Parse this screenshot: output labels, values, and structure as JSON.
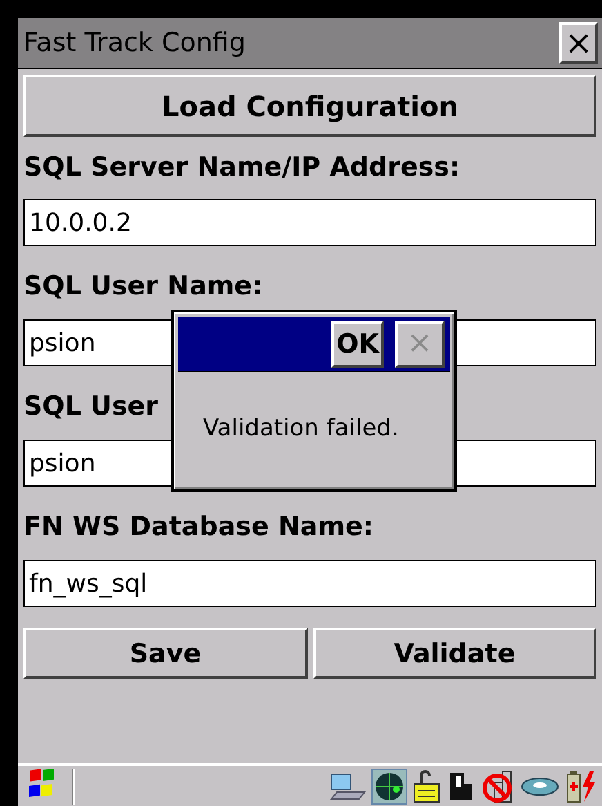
{
  "window": {
    "title": "Fast Track Config",
    "close": "×"
  },
  "load_button": "Load Configuration",
  "fields": [
    {
      "label": "SQL Server Name/IP Address:",
      "value": "10.0.0.2"
    },
    {
      "label": "SQL User Name:",
      "value": "psion"
    },
    {
      "label": "SQL User",
      "value": "psion"
    },
    {
      "label": "FN WS Database Name:",
      "value": "fn_ws_sql"
    }
  ],
  "buttons": [
    "Save",
    "Validate"
  ],
  "dialog": {
    "ok": "OK",
    "close": "×",
    "close_disabled": true,
    "message": "Validation failed."
  }
}
